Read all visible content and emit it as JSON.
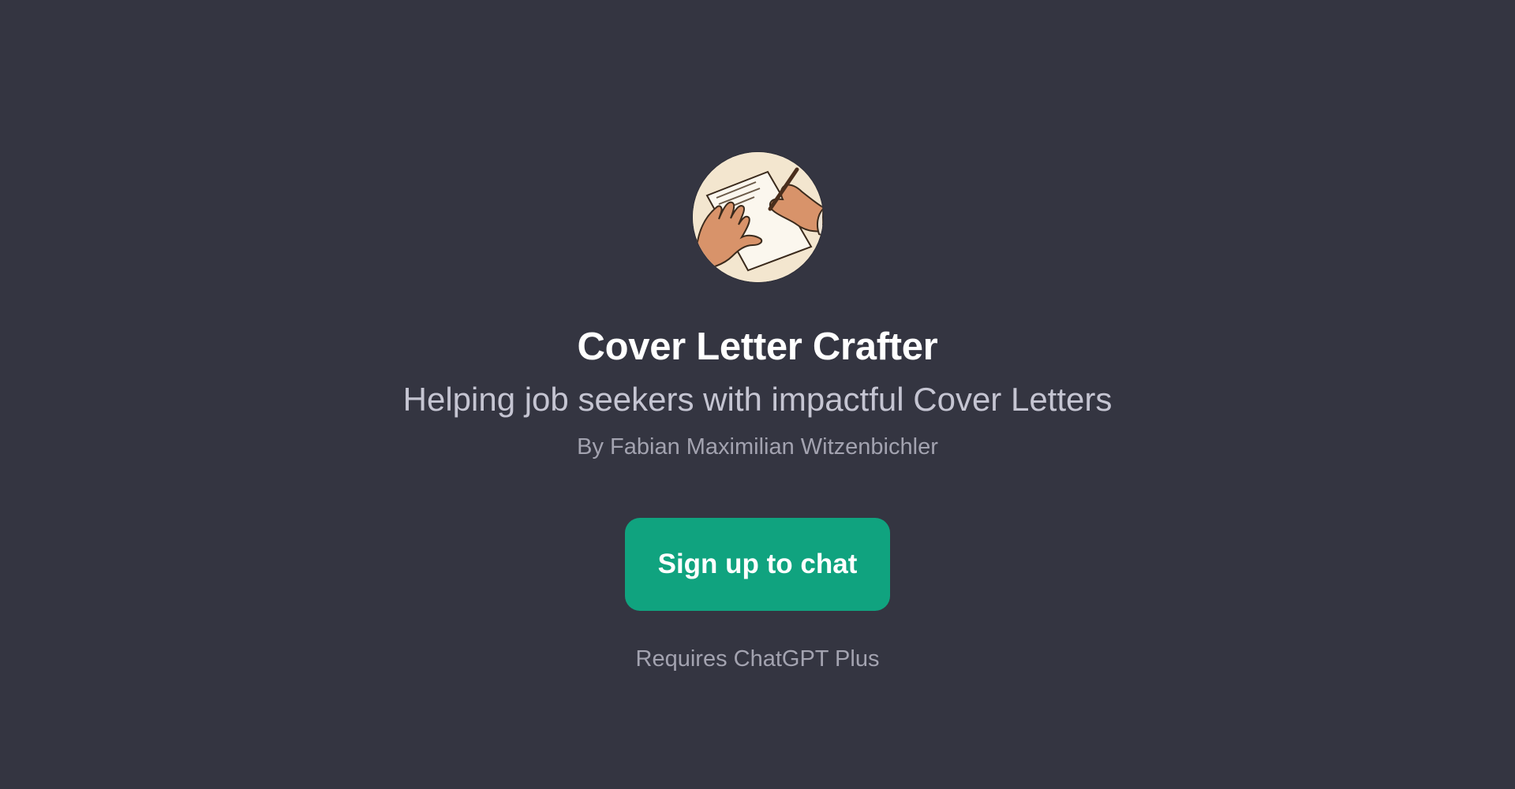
{
  "gpt": {
    "avatar_icon": "writing-hands-icon",
    "title": "Cover Letter Crafter",
    "description": "Helping job seekers with impactful Cover Letters",
    "author": "By Fabian Maximilian Witzenbichler"
  },
  "cta": {
    "label": "Sign up to chat"
  },
  "note": "Requires ChatGPT Plus",
  "colors": {
    "background": "#343541",
    "accent": "#10a37f",
    "title": "#ffffff",
    "subtitle": "#c5c5d2",
    "muted": "#a3a3b0"
  }
}
